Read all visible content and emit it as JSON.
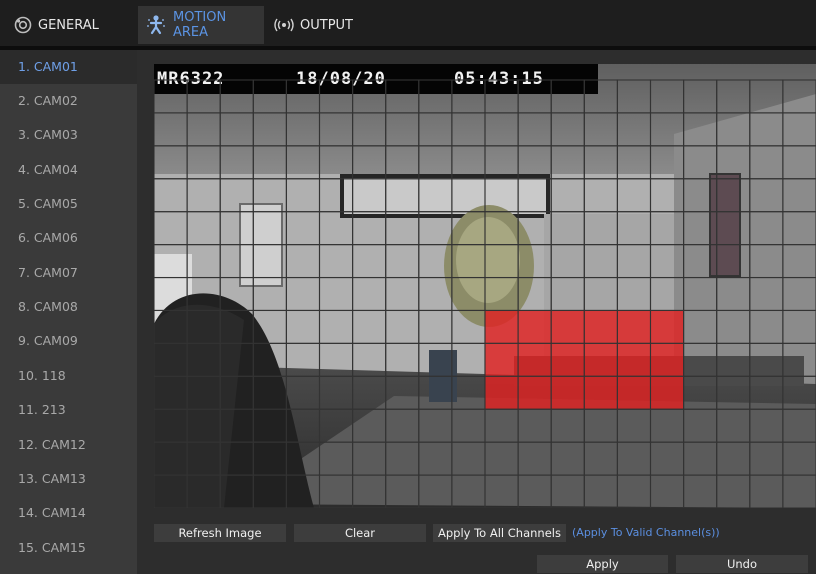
{
  "tabs": [
    {
      "label": "GENERAL",
      "icon": "gear-icon",
      "active": false
    },
    {
      "label": "MOTION AREA",
      "icon": "motion-figure-icon",
      "active": true
    },
    {
      "label": "OUTPUT",
      "icon": "signal-wave-icon",
      "active": false
    }
  ],
  "cameras": [
    {
      "label": "1. CAM01",
      "selected": true
    },
    {
      "label": "2. CAM02"
    },
    {
      "label": "3. CAM03"
    },
    {
      "label": "4. CAM04"
    },
    {
      "label": "5. CAM05"
    },
    {
      "label": "6. CAM06"
    },
    {
      "label": "7. CAM07"
    },
    {
      "label": "8. CAM08"
    },
    {
      "label": "9. CAM09"
    },
    {
      "label": "10. 118"
    },
    {
      "label": "11. 213"
    },
    {
      "label": "12. CAM12"
    },
    {
      "label": "13. CAM13"
    },
    {
      "label": "14. CAM14"
    },
    {
      "label": "15. CAM15"
    }
  ],
  "osd": {
    "cam_id": "MR6322",
    "date": "18/08/20",
    "time": "05:43:15"
  },
  "motion_grid": {
    "cols": 20,
    "rows": 13,
    "active_cells": {
      "col_start": 10,
      "col_end": 15,
      "row_start": 7,
      "row_end": 9
    },
    "active_color": "#e02222"
  },
  "buttons": {
    "refresh": "Refresh Image",
    "clear": "Clear",
    "apply_all": "Apply To All Channels",
    "apply_valid": "(Apply To Valid Channel(s))",
    "apply": "Apply",
    "undo": "Undo"
  },
  "colors": {
    "accent": "#5b94e4",
    "active_tab_bg": "#343434",
    "sidebar_bg": "#3a3a3a"
  }
}
